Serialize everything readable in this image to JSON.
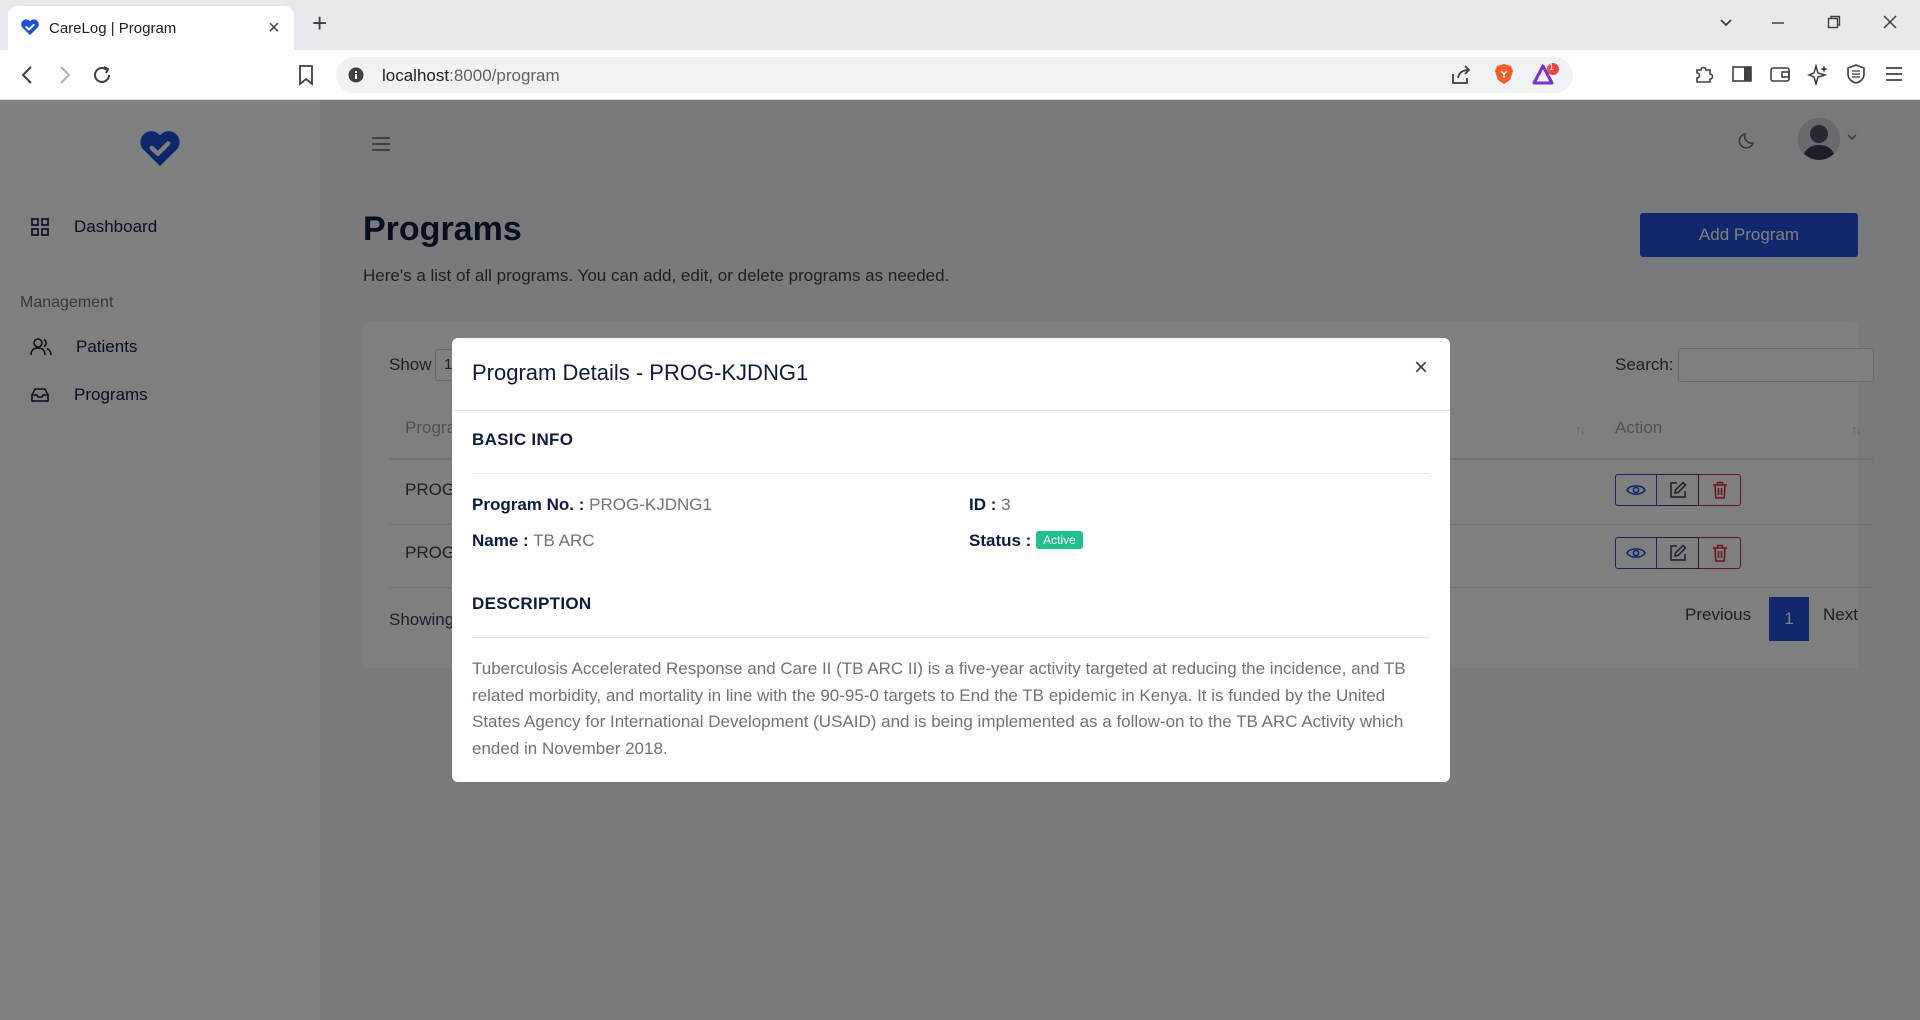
{
  "browser": {
    "tab_title": "CareLog | Program",
    "url_host": "localhost",
    "url_rest": ":8000/program",
    "notification_count": "1"
  },
  "sidebar": {
    "items": [
      {
        "label": "Dashboard",
        "icon": "grid-icon"
      },
      {
        "label": "Patients",
        "icon": "users-icon"
      },
      {
        "label": "Programs",
        "icon": "inbox-icon"
      }
    ],
    "section_label": "Management"
  },
  "page": {
    "title": "Programs",
    "subtitle": "Here's a list of all programs. You can add, edit, or delete programs as needed.",
    "add_button": "Add Program"
  },
  "table": {
    "show_label": "Show",
    "show_value": "1",
    "search_label": "Search:",
    "headers": {
      "first": "Progra",
      "action": "Action"
    },
    "rows": [
      {
        "program": "PROG"
      },
      {
        "program": "PROG"
      }
    ],
    "showing_text": "Showing",
    "pagination": {
      "previous": "Previous",
      "current": "1",
      "next": "Next"
    }
  },
  "modal": {
    "title": "Program Details - PROG-KJDNG1",
    "basic_info_title": "BASIC INFO",
    "program_no_label": "Program No. :",
    "program_no_value": "PROG-KJDNG1",
    "id_label": "ID :",
    "id_value": "3",
    "name_label": "Name :",
    "name_value": "TB ARC",
    "status_label": "Status :",
    "status_value": "Active",
    "description_title": "DESCRIPTION",
    "description": "Tuberculosis Accelerated Response and Care II (TB ARC II) is a five-year activity targeted at reducing the incidence, and TB related morbidity, and mortality in line with the 90-95-0 targets to End the TB epidemic in Kenya. It is funded by the United States Agency for International Development (USAID) and is being implemented as a follow-on to the TB ARC Activity which ended in November 2018."
  },
  "colors": {
    "brand": "#1e4fd8",
    "status_active": "#1fbf8f",
    "danger": "#dc2626"
  }
}
